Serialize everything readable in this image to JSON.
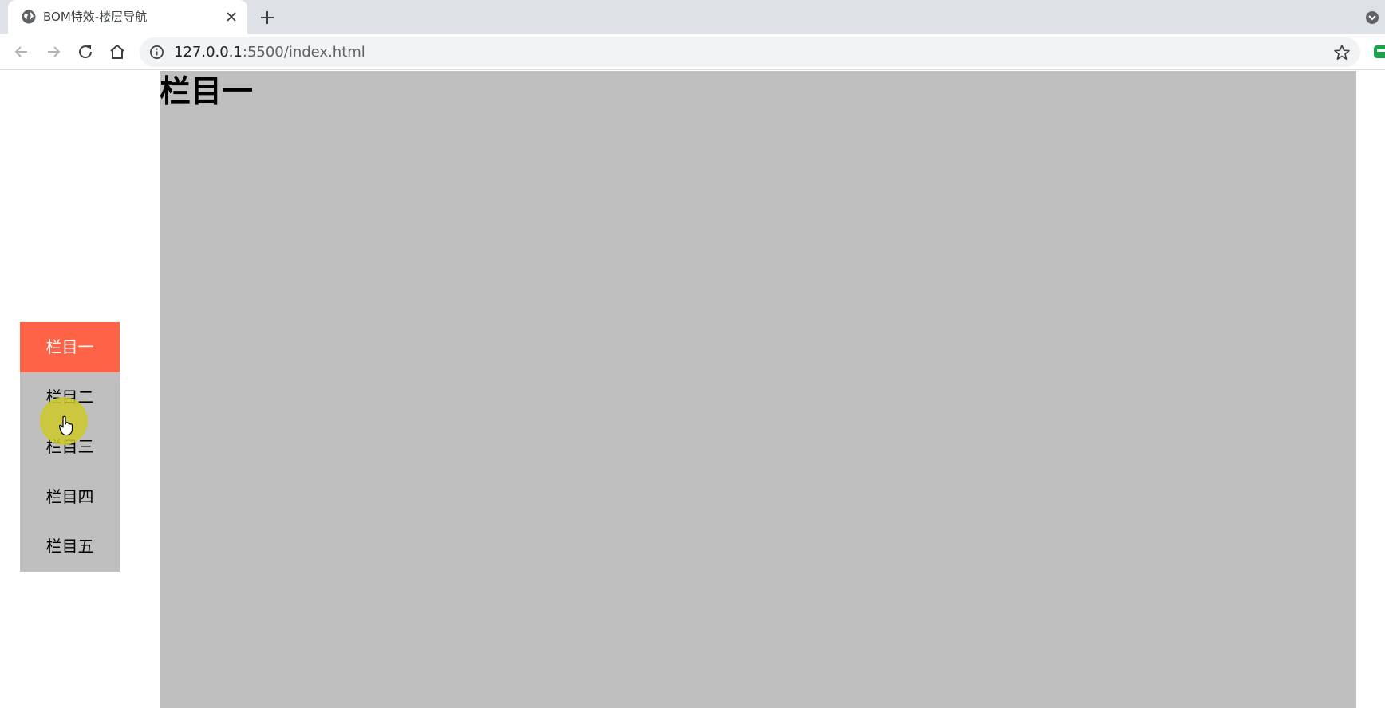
{
  "browser": {
    "tab": {
      "title": "BOM特效-楼层导航",
      "favicon": "globe-icon",
      "close": "close-icon"
    },
    "new_tab": "plus-icon",
    "address": {
      "host": "127.0.0.1",
      "rest": ":5500/index.html"
    },
    "nav_icons": [
      "back-arrow-icon",
      "forward-arrow-icon",
      "reload-icon",
      "home-icon"
    ],
    "bookmark": "star-icon"
  },
  "page": {
    "section_title": "栏目一",
    "colors": {
      "section_bg": "#bfbfbf",
      "nav_active_bg": "#ff6347",
      "nav_active_text": "#ffffff",
      "nav_bg": "#bfbfbf"
    },
    "nav_items": [
      {
        "label": "栏目一",
        "active": true
      },
      {
        "label": "栏目二",
        "active": false
      },
      {
        "label": "栏目三",
        "active": false
      },
      {
        "label": "栏目四",
        "active": false
      },
      {
        "label": "栏目五",
        "active": false
      }
    ]
  }
}
